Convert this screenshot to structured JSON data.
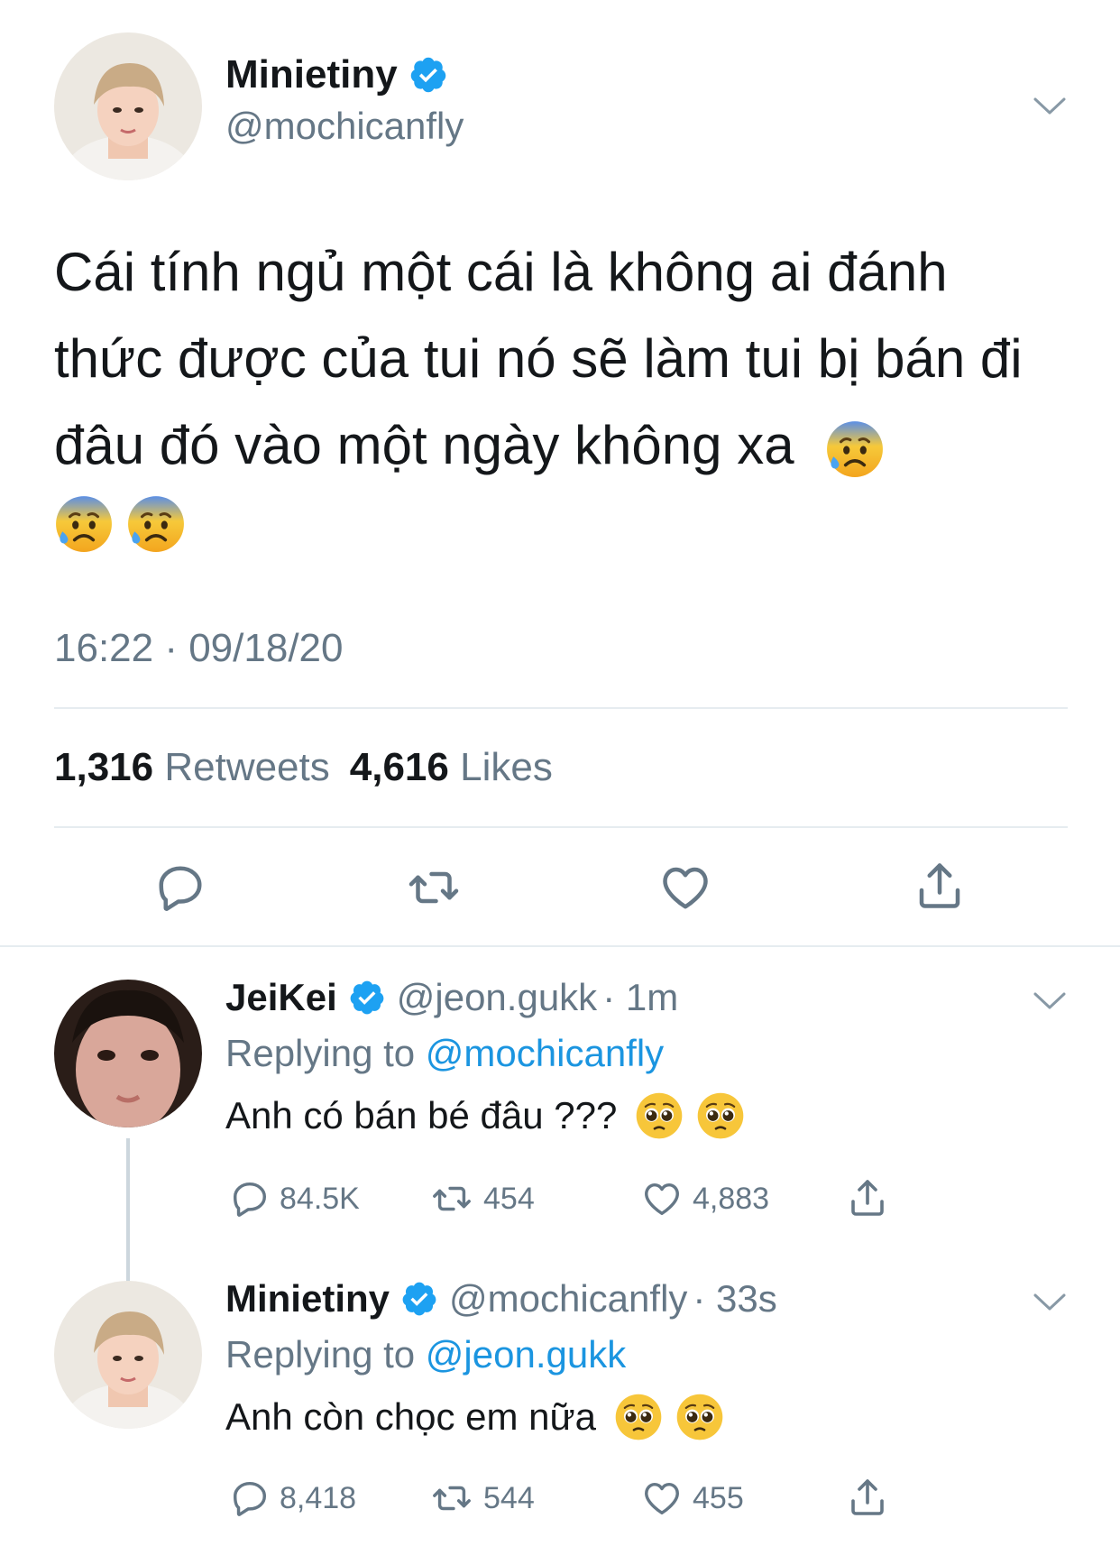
{
  "main_tweet": {
    "display_name": "Minietiny",
    "handle": "@mochicanfly",
    "text": "Cái tính ngủ một cái là không ai đánh thức được của tui nó sẽ làm tui bị bán đi đâu đó vào một ngày không xa",
    "text_emojis": [
      "anxious-face-with-sweat",
      "anxious-face-with-sweat",
      "anxious-face-with-sweat"
    ],
    "timestamp": "16:22 · 09/18/20",
    "retweets_count": "1,316",
    "retweets_label": "Retweets",
    "likes_count": "4,616",
    "likes_label": "Likes",
    "actions": [
      "reply-icon",
      "retweet-icon",
      "like-icon",
      "share-icon"
    ]
  },
  "replies": [
    {
      "display_name": "JeiKei",
      "handle": "@jeon.gukk",
      "time": "· 1m",
      "replying_prefix": "Replying to",
      "replying_to": "@mochicanfly",
      "text": "Anh có bán bé đâu ???",
      "text_emojis": [
        "pleading-face",
        "pleading-face"
      ],
      "reply_count": "84.5K",
      "retweet_count": "454",
      "like_count": "4,883"
    },
    {
      "display_name": "Minietiny",
      "handle": "@mochicanfly",
      "time": "· 33s",
      "replying_prefix": "Replying to",
      "replying_to": "@jeon.gukk",
      "text": "Anh còn chọc em nữa",
      "text_emojis": [
        "pleading-face",
        "pleading-face"
      ],
      "reply_count": "8,418",
      "retweet_count": "544",
      "like_count": "455"
    }
  ],
  "colors": {
    "text": "#14171a",
    "muted": "#657786",
    "link": "#1b95e0",
    "verified": "#1da1f2",
    "divider": "#e6ecf0"
  }
}
